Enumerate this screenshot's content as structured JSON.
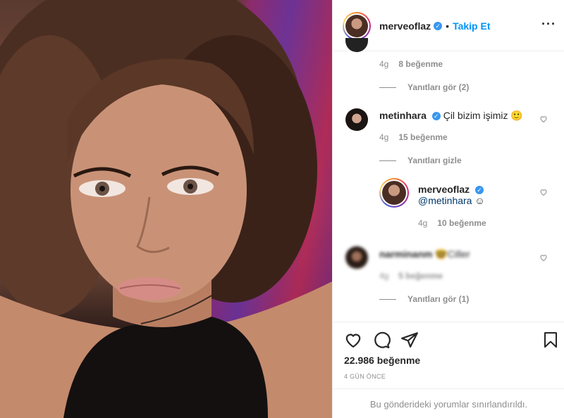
{
  "header": {
    "username": "merveoflaz",
    "separator": "•",
    "follow_label": "Takip Et",
    "more_icon": "···"
  },
  "comments": [
    {
      "time": "4g",
      "likes": "8 beğenme",
      "replies_label": "Yanıtları gör (2)"
    },
    {
      "username": "metinhara",
      "text": "Çil bizim işimiz 🙂",
      "time": "4g",
      "likes": "15 beğenme",
      "replies_label": "Yanıtları gizle"
    },
    {
      "username": "merveoflaz",
      "mention": "@metinhara",
      "emoji": "☺",
      "time": "4g",
      "likes": "10 beğenme"
    },
    {
      "username": "narminanm",
      "text": "🤓Ciller",
      "time": "4g",
      "likes": "5 beğenme",
      "replies_label": "Yanıtları gör (1)"
    }
  ],
  "actions": {
    "likes_count": "22.986 beğenme",
    "time_ago": "4 GÜN ÖNCE",
    "restricted_notice": "Bu gönderideki yorumlar sınırlandırıldı."
  },
  "icons": [
    "heart-icon",
    "comment-icon",
    "share-icon",
    "bookmark-icon",
    "verified-badge-icon",
    "more-options-icon"
  ],
  "colors": {
    "accent": "#0095f6",
    "verified": "#3897f0",
    "muted": "#8e8e8e"
  }
}
